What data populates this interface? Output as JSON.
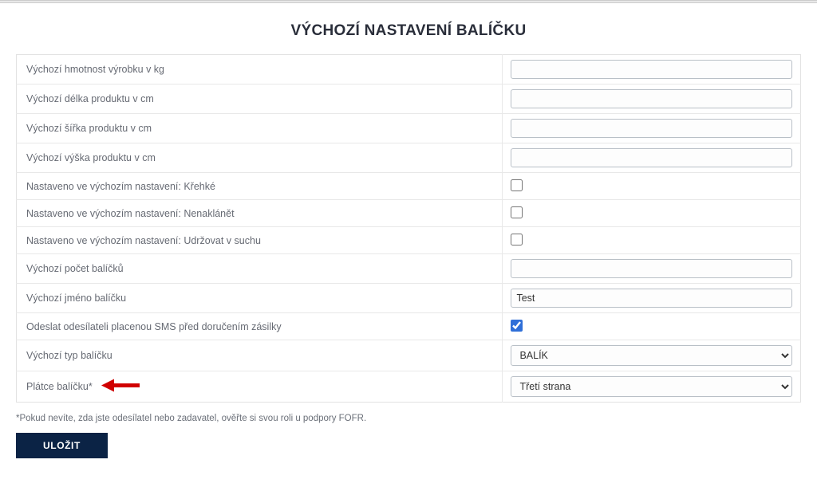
{
  "title": "VÝCHOZÍ NASTAVENÍ BALÍČKU",
  "rows": {
    "weight": {
      "label": "Výchozí hmotnost výrobku v kg",
      "value": ""
    },
    "length": {
      "label": "Výchozí délka produktu v cm",
      "value": ""
    },
    "width": {
      "label": "Výchozí šířka produktu v cm",
      "value": ""
    },
    "height": {
      "label": "Výchozí výška produktu v cm",
      "value": ""
    },
    "fragile": {
      "label": "Nastaveno ve výchozím nastavení: Křehké"
    },
    "tilt": {
      "label": "Nastaveno ve výchozím nastavení: Nenaklánět"
    },
    "dry": {
      "label": "Nastaveno ve výchozím nastavení: Udržovat v suchu"
    },
    "count": {
      "label": "Výchozí počet balíčků",
      "value": ""
    },
    "name": {
      "label": "Výchozí jméno balíčku",
      "value": "Test"
    },
    "sms": {
      "label": "Odeslat odesílateli placenou SMS před doručením zásilky"
    },
    "type": {
      "label": "Výchozí typ balíčku",
      "selected": "BALÍK"
    },
    "payer": {
      "label": "Plátce balíčku*",
      "selected": "Třetí strana"
    }
  },
  "selects": {
    "type_options": [
      "BALÍK"
    ],
    "payer_options": [
      "Třetí strana"
    ]
  },
  "note": "*Pokud nevíte, zda jste odesílatel nebo zadavatel, ověřte si svou roli u podpory FOFR.",
  "save": "ULOŽIT"
}
